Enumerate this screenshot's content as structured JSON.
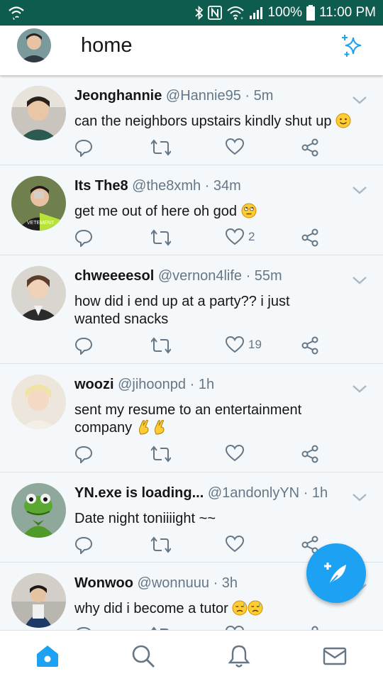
{
  "status_bar": {
    "battery": "100%",
    "time": "11:00 PM",
    "icons": [
      "wifi-call-icon",
      "bluetooth-icon",
      "nfc-icon",
      "wifi-icon",
      "signal-icon",
      "battery-icon"
    ]
  },
  "header": {
    "title": "home",
    "icons": [
      "profile-avatar",
      "sparkle-icon"
    ]
  },
  "colors": {
    "status_bar": "#0e5c4e",
    "accent": "#1da1f2",
    "muted": "#657786",
    "feed_bg": "#f5f8fa"
  },
  "tweets": [
    {
      "name": "Jeonghannie",
      "handle": "@Hannie95",
      "time": "· 5m",
      "text": "can the neighbors upstairs kindly shut up",
      "emoji": [
        "slightly-smiling-face"
      ],
      "likes": ""
    },
    {
      "name": "Its The8",
      "handle": "@the8xmh",
      "time": "· 34m",
      "text": "get me out of here oh god",
      "emoji": [
        "eye-roll-face"
      ],
      "likes": "2"
    },
    {
      "name": "chweeeesol",
      "handle": "@vernon4life",
      "time": "· 55m",
      "text": "how did i end up at a party?? i just wanted snacks",
      "emoji": [],
      "likes": "19"
    },
    {
      "name": "woozi",
      "handle": "@jihoonpd",
      "time": "· 1h",
      "text": "sent my resume to an entertainment company",
      "emoji": [
        "crossed-fingers",
        "crossed-fingers"
      ],
      "likes": ""
    },
    {
      "name": "YN.exe is loading...",
      "handle": "@1andonlyYN",
      "time": "· 1h",
      "text": "Date night toniiiight ~~",
      "emoji": [],
      "likes": ""
    },
    {
      "name": "Wonwoo",
      "handle": "@wonnuuu",
      "time": "· 3h",
      "text": "why did i become a tutor",
      "emoji": [
        "sad-sweat-face",
        "sad-sweat-face"
      ],
      "likes": ""
    }
  ],
  "fab": {
    "icon": "compose-feather-icon"
  },
  "bottom_nav": [
    "home-icon",
    "search-icon",
    "notifications-icon",
    "messages-icon"
  ]
}
